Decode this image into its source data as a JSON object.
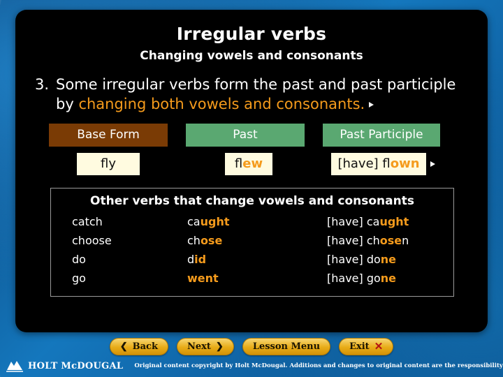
{
  "slide": {
    "title": "Irregular verbs",
    "subtitle": "Changing vowels and consonants",
    "bullet_number": "3.",
    "bullet_text_plain": "Some irregular verbs form the past and past participle by ",
    "bullet_text_highlight": "changing both vowels and consonants.",
    "columns": {
      "base": "Base Form",
      "past": "Past",
      "past_participle": "Past Participle"
    },
    "example": {
      "base": "fly",
      "past_prefix": "fl",
      "past_suffix": "ew",
      "pp_prefix": "[have] fl",
      "pp_suffix": "own"
    },
    "panel": {
      "title": "Other verbs that change vowels and consonants",
      "rows": [
        {
          "base": "catch",
          "past_prefix": "ca",
          "past_suffix": "ught",
          "pp_prefix": "[have] ca",
          "pp_suffix": "ught"
        },
        {
          "base": "choose",
          "past_prefix": "ch",
          "past_suffix": "ose",
          "pp_prefix": "[have] ch",
          "pp_suffix": "ose",
          "pp_tail": "n"
        },
        {
          "base": "do",
          "past_prefix": "d",
          "past_suffix": "id",
          "pp_prefix": "[have] do",
          "pp_suffix": "ne"
        },
        {
          "base": "go",
          "past_prefix": "",
          "past_suffix": "went",
          "pp_prefix": "[have] go",
          "pp_suffix": "ne"
        }
      ]
    }
  },
  "nav": {
    "back": "Back",
    "next": "Next",
    "lesson_menu": "Lesson Menu",
    "exit": "Exit",
    "back_glyph": "❮",
    "next_glyph": "❯",
    "exit_glyph": "✕"
  },
  "footer": {
    "brand": "HOLT McDOUGAL",
    "copyright": "Original content copyright by Holt McDougal. Additions and changes to original content are the responsibility of the instructor."
  },
  "colors": {
    "highlight": "#f59b1c",
    "base_chip": "#7a3b05",
    "past_chip": "#5aa871",
    "word_box": "#fffbe0",
    "slide_bg": "#000000"
  }
}
